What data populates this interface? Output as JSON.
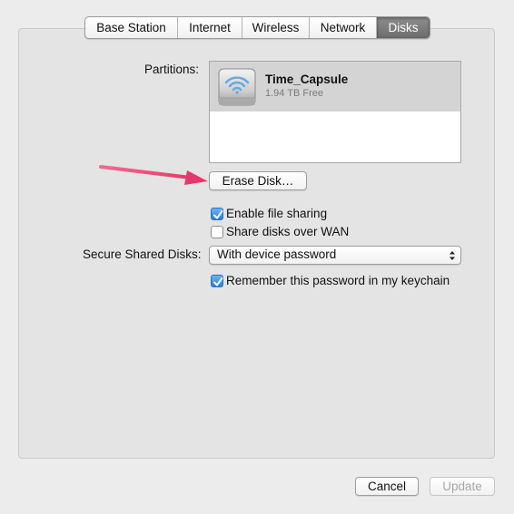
{
  "tabs": [
    {
      "label": "Base Station"
    },
    {
      "label": "Internet"
    },
    {
      "label": "Wireless"
    },
    {
      "label": "Network"
    },
    {
      "label": "Disks"
    }
  ],
  "active_tab": "Disks",
  "partitions": {
    "label": "Partitions:",
    "items": [
      {
        "name": "Time_Capsule",
        "free": "1.94 TB Free",
        "icon": "wifi-disk-icon"
      }
    ]
  },
  "erase_button": "Erase Disk…",
  "file_sharing": {
    "label": "Enable file sharing",
    "checked": true
  },
  "share_wan": {
    "label": "Share disks over WAN",
    "checked": false
  },
  "secure_disks": {
    "label": "Secure Shared Disks:",
    "value": "With device password"
  },
  "remember_password": {
    "label": "Remember this password in my keychain",
    "checked": true
  },
  "footer": {
    "cancel": "Cancel",
    "update": "Update",
    "update_enabled": false
  },
  "annotation": {
    "color": "#e8386b",
    "icon": "pointer-arrow"
  }
}
